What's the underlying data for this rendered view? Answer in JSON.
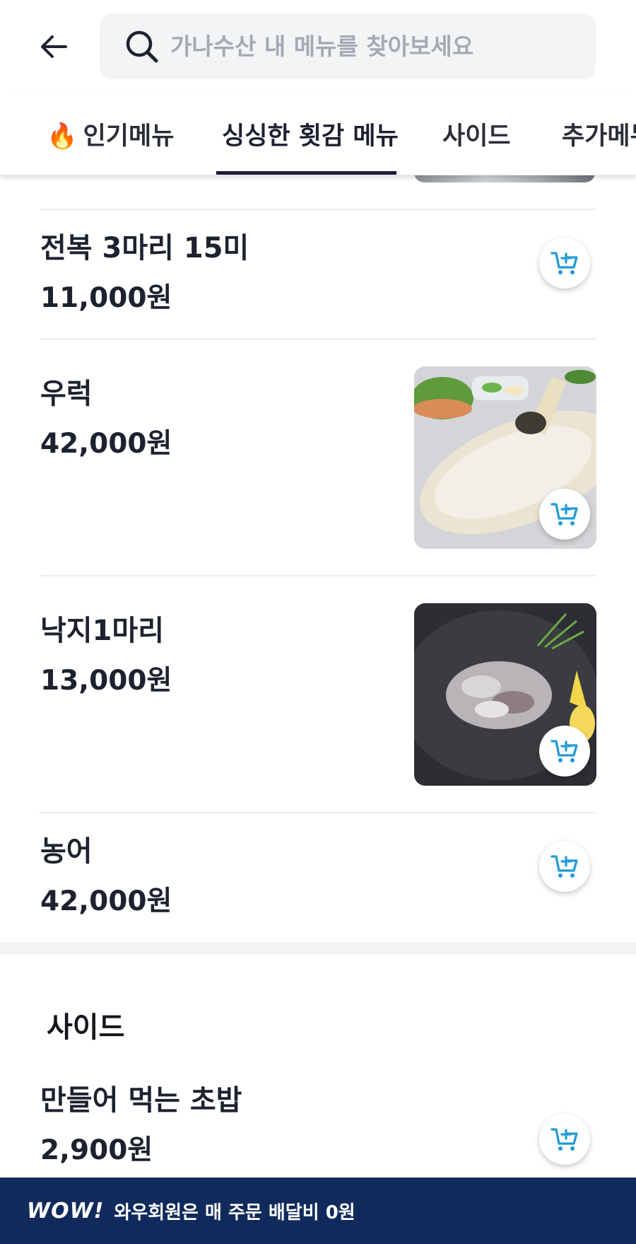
{
  "search": {
    "placeholder": "가나수산 내 메뉴를 찾아보세요"
  },
  "tabs": [
    {
      "icon": "🔥",
      "label": "인기메뉴"
    },
    {
      "label": "싱싱한 횟감 메뉴",
      "active": true
    },
    {
      "label": "사이드"
    },
    {
      "label": "추가메뉴"
    }
  ],
  "items": [
    {
      "name": "전복 3마리 15미",
      "price": "11,000원"
    },
    {
      "name": "우럭",
      "price": "42,000원"
    },
    {
      "name": "낙지1마리",
      "price": "13,000원"
    },
    {
      "name": "농어",
      "price": "42,000원"
    }
  ],
  "side_section": {
    "title": "사이드",
    "items": [
      {
        "name": "만들어 먹는 초밥",
        "price": "2,900원"
      }
    ]
  },
  "footer": {
    "badge": "WOW!",
    "text": "와우회원은 매 주문 배달비 0원"
  },
  "colors": {
    "cart_icon": "#1f9bd8",
    "footer_bg": "#112a5c",
    "tab_underline": "#1b1a3a"
  }
}
